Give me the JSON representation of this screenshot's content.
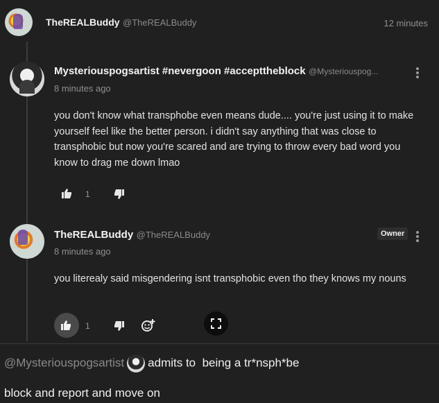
{
  "top_bar": {
    "user_name": "TheREALBuddy",
    "user_handle": "@TheREALBuddy",
    "time": "12 minutes"
  },
  "reply_1": {
    "user_name": "Mysteriouspogsartist #nevergoon #accepttheblock",
    "user_handle": "@Mysteriouspog...",
    "time": "8 minutes ago",
    "text": "you don't know what transphobe even means dude.... you're just using it to make yourself feel like the better person. i didn't say anything that was close to transphobic but now you're scared and are trying to throw every bad word you know to drag me down lmao",
    "like_count": "1",
    "icons": {
      "like": "thumbs-up-icon",
      "dislike": "thumbs-down-icon",
      "menu": "kebab-menu-icon"
    }
  },
  "reply_2": {
    "user_name": "TheREALBuddy",
    "user_handle": "@TheREALBuddy",
    "badge": "Owner",
    "time": "8 minutes ago",
    "text": "you literealy said misgendering isnt transphobic even tho they knows my nouns",
    "like_count": "1",
    "icons": {
      "like": "thumbs-up-icon",
      "dislike": "thumbs-down-icon",
      "emoji": "add-reaction-icon",
      "expand": "expand-icon",
      "menu": "kebab-menu-icon"
    }
  },
  "caption": {
    "mention": "@Mysteriouspogsartist",
    "text_after_avatar": "admits to  being a tr*nsph*be",
    "footer": "block and report and move on"
  },
  "colors": {
    "background": "#202020",
    "text": "#e6e6e6",
    "muted": "#8a8a8a"
  }
}
